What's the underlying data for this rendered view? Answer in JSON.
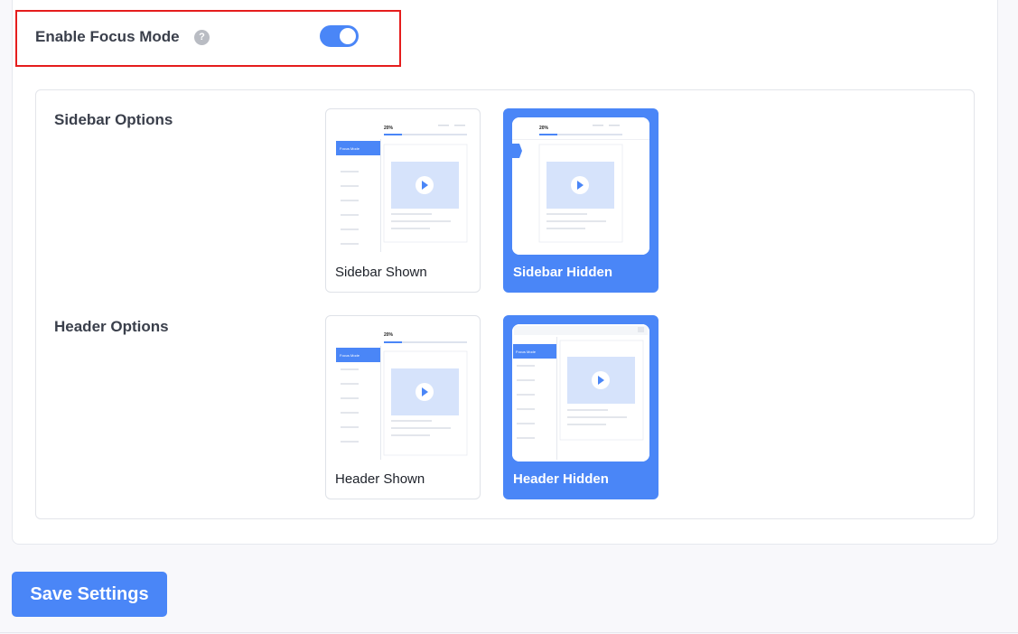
{
  "focus_mode": {
    "label": "Enable Focus Mode",
    "help_icon": "?",
    "enabled": true,
    "accent_color": "#4a86f7",
    "highlight_color": "#e51d1d"
  },
  "sidebar_options": {
    "label": "Sidebar Options",
    "options": [
      {
        "label": "Sidebar Shown",
        "selected": false
      },
      {
        "label": "Sidebar Hidden",
        "selected": true
      }
    ]
  },
  "header_options": {
    "label": "Header Options",
    "options": [
      {
        "label": "Header Shown",
        "selected": false
      },
      {
        "label": "Header Hidden",
        "selected": true
      }
    ]
  },
  "preview": {
    "progress_text": "20%",
    "sidebar_item_text": "Focus Mode"
  },
  "actions": {
    "save_label": "Save Settings"
  }
}
